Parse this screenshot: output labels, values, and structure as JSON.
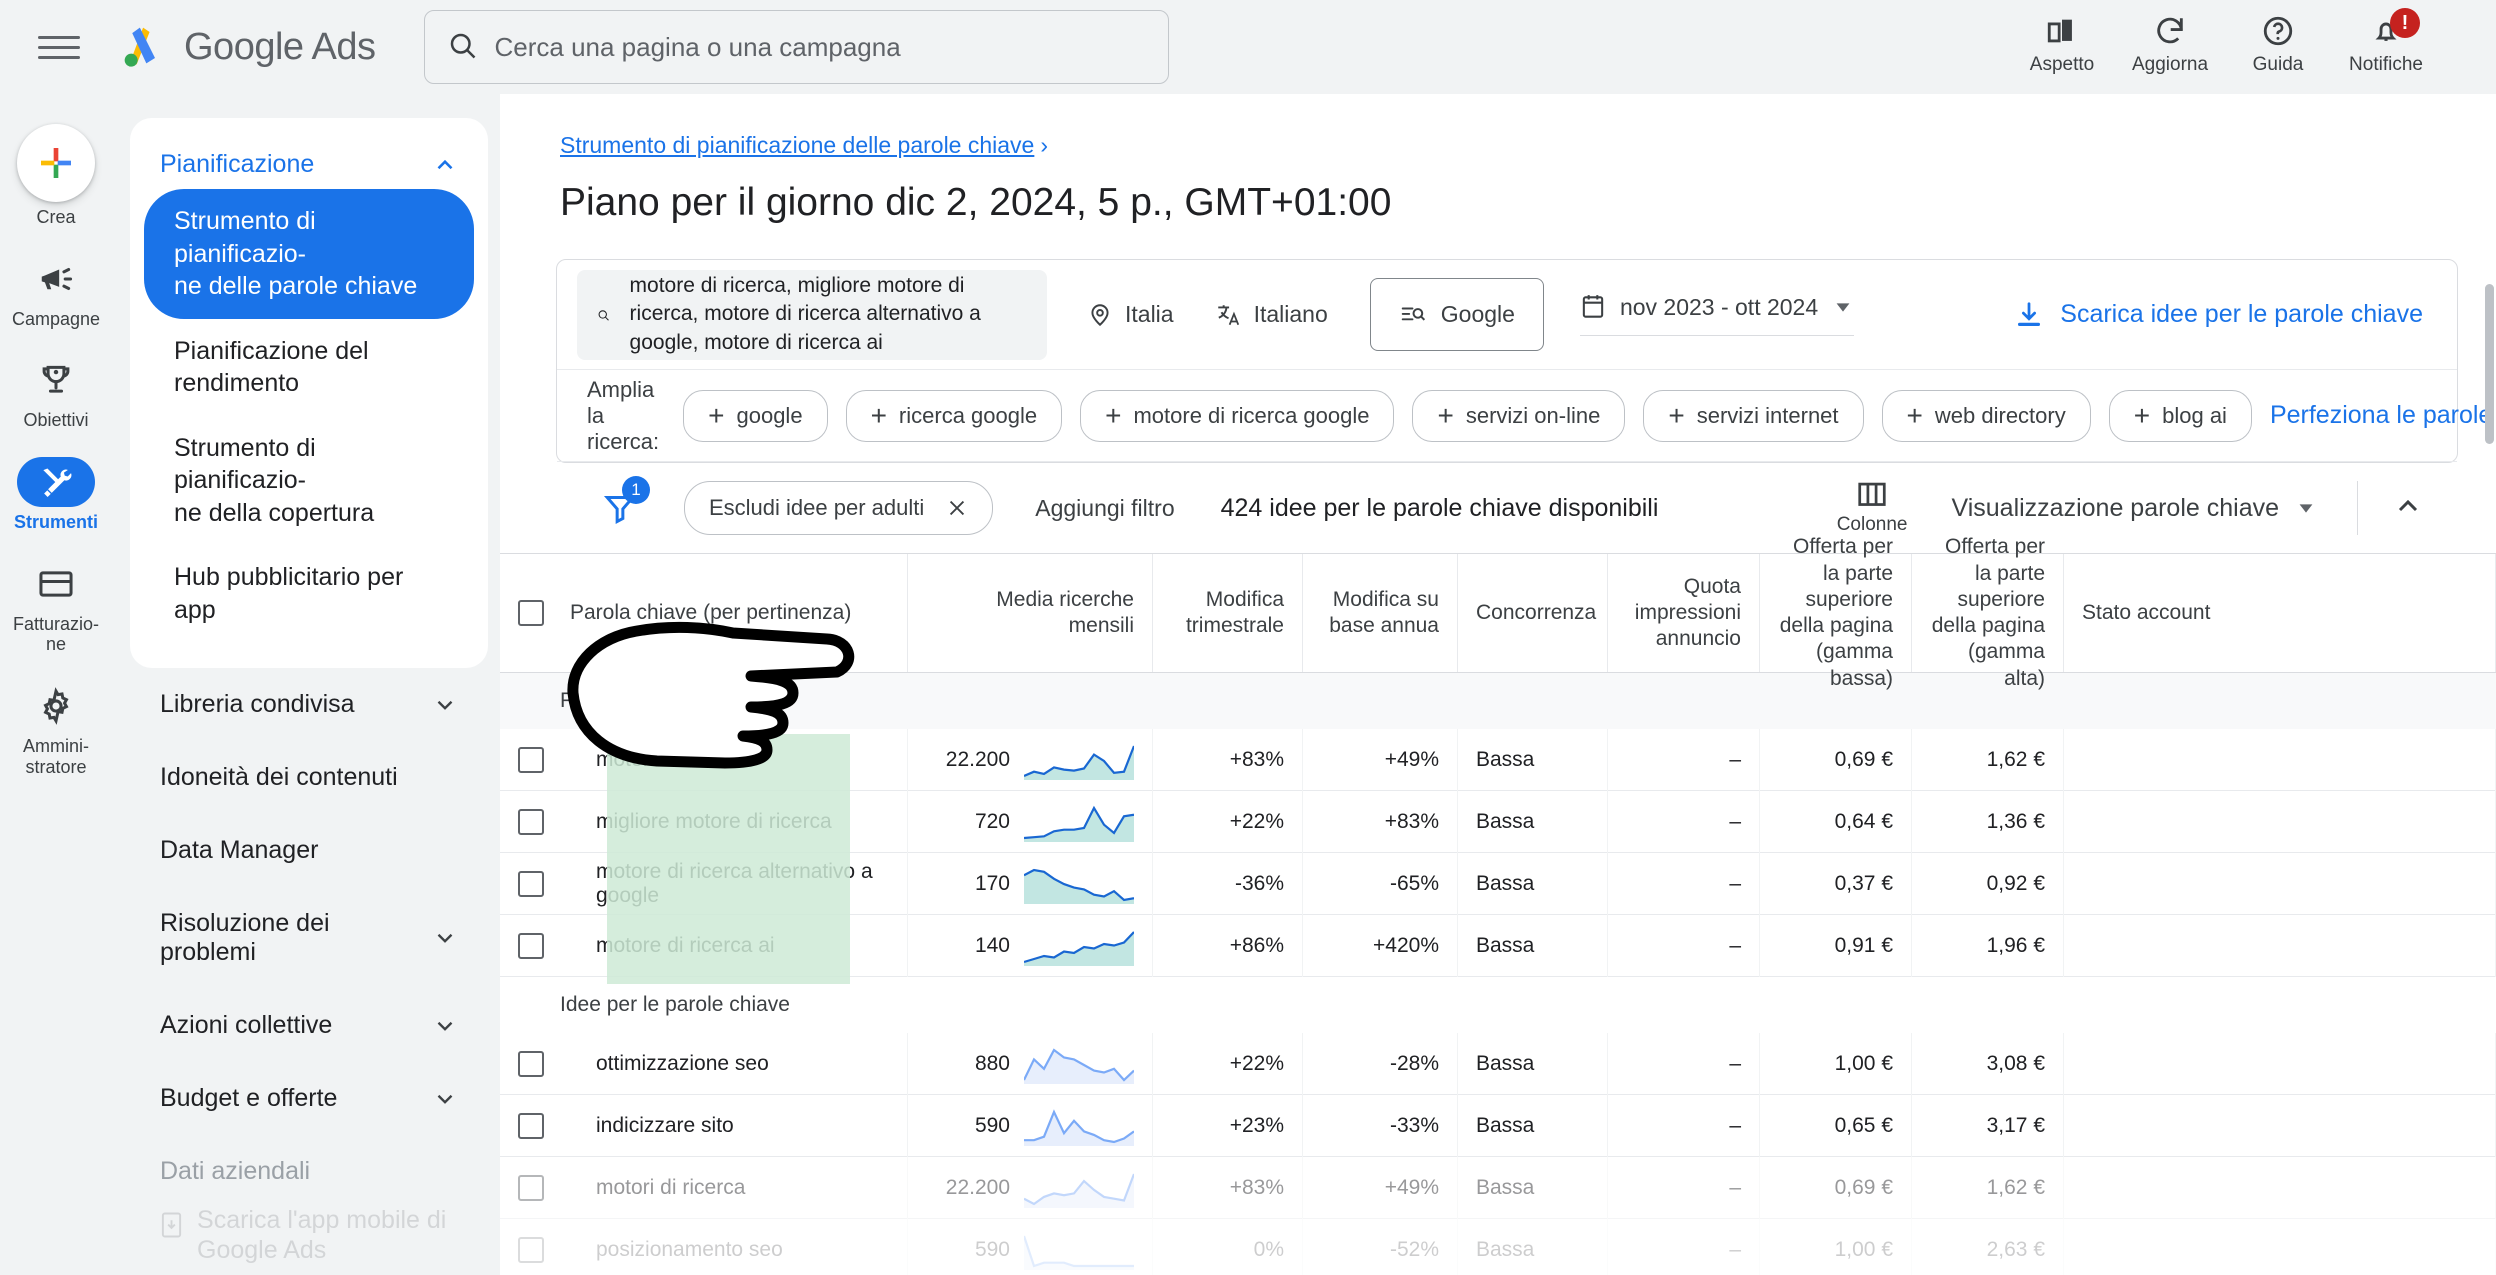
{
  "topbar": {
    "brand_google": "Google",
    "brand_ads": "Ads",
    "search_placeholder": "Cerca una pagina o una campagna",
    "search_value": "",
    "actions": [
      {
        "label": "Aspetto",
        "icon": "appearance-icon"
      },
      {
        "label": "Aggiorna",
        "icon": "refresh-icon"
      },
      {
        "label": "Guida",
        "icon": "help-icon"
      },
      {
        "label": "Notifiche",
        "icon": "bell-icon",
        "badge": "!"
      }
    ]
  },
  "rail": {
    "create_label": "Crea",
    "items": [
      {
        "label": "Campagne",
        "icon": "megaphone-icon",
        "active": false
      },
      {
        "label": "Obiettivi",
        "icon": "trophy-icon",
        "active": false
      },
      {
        "label": "Strumenti",
        "icon": "tools-icon",
        "active": true
      },
      {
        "label": "Fatturazio-\nne",
        "icon": "credit-card-icon",
        "active": false
      },
      {
        "label": "Ammini-\nstratore",
        "icon": "gear-icon",
        "active": false
      }
    ]
  },
  "sidebar": {
    "section_title": "Pianificazione",
    "sub_items": [
      {
        "label": "Strumento di pianificazio-ne delle parole chiave",
        "active": true
      },
      {
        "label": "Pianificazione del rendimento",
        "active": false
      },
      {
        "label": "Strumento di pianificazio-ne della copertura",
        "active": false
      },
      {
        "label": "Hub pubblicitario per app",
        "active": false
      }
    ],
    "groups": [
      {
        "label": "Libreria condivisa",
        "expandable": true,
        "muted": false
      },
      {
        "label": "Idoneità dei contenuti",
        "expandable": false,
        "muted": false
      },
      {
        "label": "Data Manager",
        "expandable": false,
        "muted": false
      },
      {
        "label": "Risoluzione dei problemi",
        "expandable": true,
        "muted": false
      },
      {
        "label": "Azioni collettive",
        "expandable": true,
        "muted": false
      },
      {
        "label": "Budget e offerte",
        "expandable": true,
        "muted": false
      },
      {
        "label": "Dati aziendali",
        "expandable": false,
        "muted": true
      }
    ],
    "footer_label": "Scarica l'app mobile di Google Ads"
  },
  "main": {
    "breadcrumb": "Strumento di pianificazione delle parole chiave",
    "breadcrumb_sep": "›",
    "page_title": "Piano per il giorno dic 2, 2024, 5 p., GMT+01:00",
    "keyword_input_value": "motore di ricerca, migliore motore di ricerca, motore di ricerca alternativo a google, motore di ricerca ai",
    "location": "Italia",
    "language": "Italiano",
    "network": "Google",
    "date_range": "nov 2023 - ott 2024",
    "download_label": "Scarica idee per le parole chiave",
    "expand_label": "Amplia la ricerca:",
    "expand_chips": [
      "google",
      "ricerca google",
      "motore di ricerca google",
      "servizi on-line",
      "servizi internet",
      "web directory",
      "blog ai"
    ],
    "refine_label": "Perfeziona le parole chiave",
    "filter_badge": "1",
    "filter_chip": "Escludi idee per adulti",
    "add_filter": "Aggiungi filtro",
    "ideas_count": "424 idee per le parole chiave disponibili",
    "columns_label": "Colonne",
    "view_label": "Visualizzazione parole chiave"
  },
  "table": {
    "headers": [
      "Parola chiave (per pertinenza)",
      "Media ricerche mensili",
      "Modifica trimestrale",
      "Modifica su base annua",
      "Concorrenza",
      "Quota impressioni annuncio",
      "Offerta per la parte superiore della pagina (gamma bassa)",
      "Offerta per la parte superiore della pagina (gamma alta)",
      "Stato account"
    ],
    "section_provided": "Parole chiave fornite",
    "section_ideas": "Idee per le parole chiave",
    "provided_rows": [
      {
        "keyword": "motore di ricerca",
        "volume": "22.200",
        "quarterly": "+83%",
        "yearly": "+49%",
        "competition": "Bassa",
        "impression_share": "–",
        "bid_low": "0,69 €",
        "bid_high": "1,62 €",
        "account_status": "",
        "spark": "22,26,24,30,28,27,29,42,36,25,26,50"
      },
      {
        "keyword": "migliore motore di ricerca",
        "volume": "720",
        "quarterly": "+22%",
        "yearly": "+83%",
        "competition": "Bassa",
        "impression_share": "–",
        "bid_low": "0,64 €",
        "bid_high": "1,36 €",
        "account_status": "",
        "spark": "14,15,16,22,24,24,26,50,30,20,40,42"
      },
      {
        "keyword": "motore di ricerca alternativo a google",
        "volume": "170",
        "quarterly": "-36%",
        "yearly": "-65%",
        "competition": "Bassa",
        "impression_share": "–",
        "bid_low": "0,37 €",
        "bid_high": "0,92 €",
        "account_status": "",
        "spark": "44,50,48,40,34,30,28,22,20,26,16,18"
      },
      {
        "keyword": "motore di ricerca ai",
        "volume": "140",
        "quarterly": "+86%",
        "yearly": "+420%",
        "competition": "Bassa",
        "impression_share": "–",
        "bid_low": "0,91 €",
        "bid_high": "1,96 €",
        "account_status": "",
        "spark": "10,14,18,16,24,22,30,28,34,32,36,50"
      }
    ],
    "idea_rows": [
      {
        "keyword": "ottimizzazione seo",
        "volume": "880",
        "quarterly": "+22%",
        "yearly": "-28%",
        "competition": "Bassa",
        "impression_share": "–",
        "bid_low": "1,00 €",
        "bid_high": "3,08 €",
        "account_status": "",
        "spark": "18,40,30,50,42,40,34,28,26,30,18,28",
        "fade": 0
      },
      {
        "keyword": "indicizzare sito",
        "volume": "590",
        "quarterly": "+23%",
        "yearly": "-33%",
        "competition": "Bassa",
        "impression_share": "–",
        "bid_low": "0,65 €",
        "bid_high": "3,17 €",
        "account_status": "",
        "spark": "18,18,22,50,26,40,28,24,18,16,20,28",
        "fade": 0
      },
      {
        "keyword": "motori di ricerca",
        "volume": "22.200",
        "quarterly": "+83%",
        "yearly": "+49%",
        "competition": "Bassa",
        "impression_share": "–",
        "bid_low": "0,69 €",
        "bid_high": "1,62 €",
        "account_status": "",
        "spark": "22,16,24,28,26,28,42,32,24,22,20,50",
        "fade": 1
      },
      {
        "keyword": "posizionamento seo",
        "volume": "590",
        "quarterly": "0%",
        "yearly": "-52%",
        "competition": "Bassa",
        "impression_share": "–",
        "bid_low": "1,00 €",
        "bid_high": "2,63 €",
        "account_status": "",
        "spark": "48,12,16,16,16,12,12,12,12,12,12,12",
        "fade": 2
      }
    ]
  },
  "colors": {
    "accent_blue": "#1a73e8",
    "highlight_green": "#ceead6",
    "spark_blue": "#4285f4",
    "badge_red": "#c5221f"
  }
}
